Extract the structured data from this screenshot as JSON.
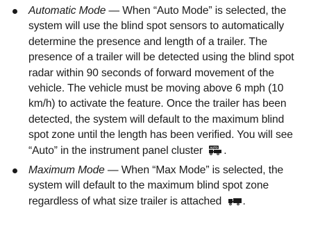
{
  "bullets": [
    {
      "term": "Automatic Mode",
      "dash": " — ",
      "text": "When “Auto Mode” is selected, the system will use the blind spot sensors to auto­matically determine the presence and length of a trailer. The presence of a trailer will be detected using the blind spot radar within 90 seconds of for­ward movement of the vehicle. The vehicle must be moving above 6 mph (10 km/h) to activate the fea­ture. Once the trailer has been detected, the system will default to the maximum blind spot zone until the length has been verified. You will see “Auto” in the instrument panel cluster",
      "icon": "auto-trailer-icon",
      "icon_label": "AUTO",
      "end": "."
    },
    {
      "term": "Maximum Mode",
      "dash": " — ",
      "text": "When “Max Mode” is selected, the system will default to the maximum blind spot zone regardless of what size trailer is attached",
      "icon": "trailer-icon",
      "end": "."
    }
  ]
}
